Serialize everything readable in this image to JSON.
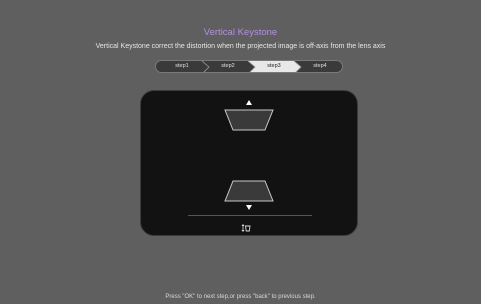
{
  "header": {
    "title": "Vertical Keystone",
    "subtitle": "Vertical Keystone correct the distortion when the projected image is off-axis from the lens axis"
  },
  "stepper": {
    "steps": [
      "step1",
      "step2",
      "step3",
      "step4"
    ],
    "active_index": 2
  },
  "panel": {
    "up_arrow_icon": "triangle-up-icon",
    "down_arrow_icon": "triangle-down-icon",
    "keystone_icon": "vertical-keystone-icon"
  },
  "footer": {
    "hint": "Press \"OK\" to next step,or press \"back\" to previous step."
  },
  "colors": {
    "background": "#5f5f5f",
    "title": "#b48ee6",
    "active_step": "#e8e8e8",
    "panel": "#121212"
  }
}
